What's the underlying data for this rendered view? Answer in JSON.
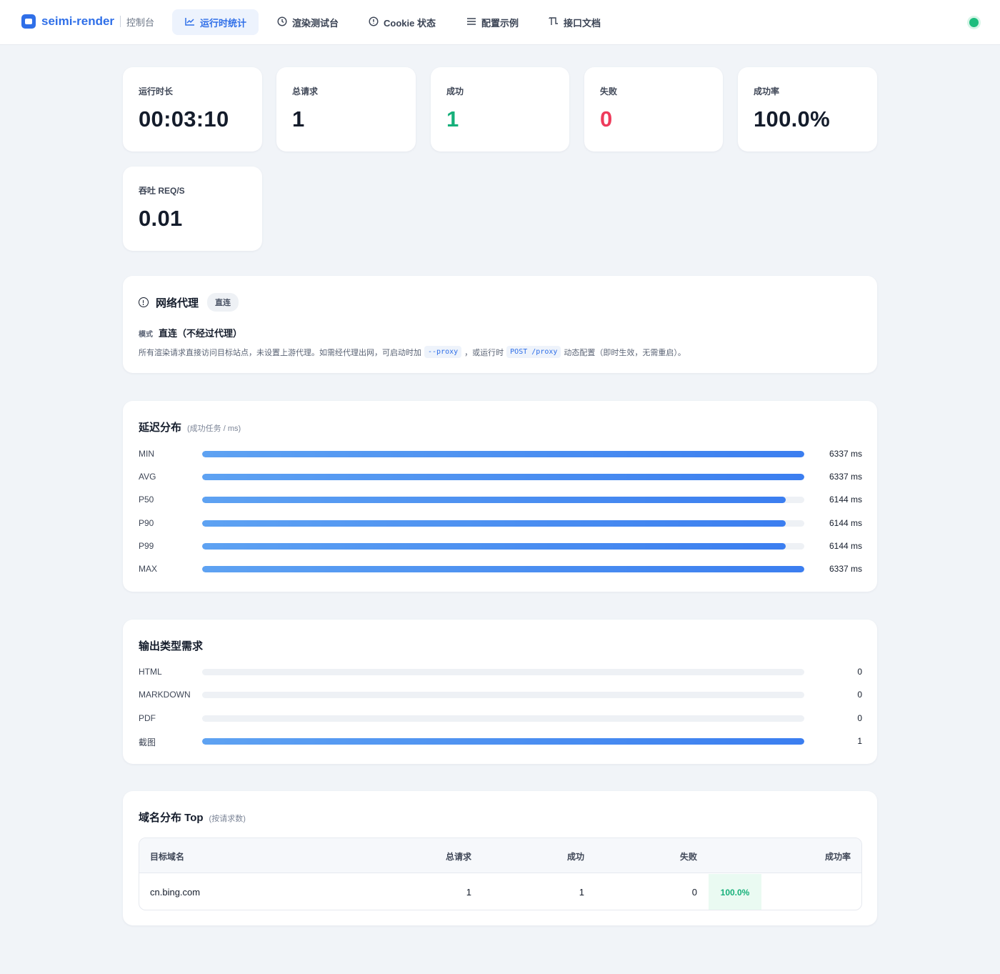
{
  "brand": {
    "name": "seimi-render",
    "subtitle": "控制台"
  },
  "nav": {
    "tabs": [
      {
        "label": "运行时统计",
        "icon": "chart-line-icon",
        "active": true
      },
      {
        "label": "渲染测试台",
        "icon": "clock-icon",
        "active": false
      },
      {
        "label": "Cookie 状态",
        "icon": "info-circle-icon",
        "active": false
      },
      {
        "label": "配置示例",
        "icon": "menu-lines-icon",
        "active": false
      },
      {
        "label": "接口文档",
        "icon": "docs-icon",
        "active": false
      }
    ],
    "status_color": "#1cbd7d"
  },
  "stats": [
    {
      "label": "运行时长",
      "value": "00:03:10"
    },
    {
      "label": "总请求",
      "value": "1"
    },
    {
      "label": "成功",
      "value": "1"
    },
    {
      "label": "失败",
      "value": "0"
    },
    {
      "label": "成功率",
      "value": "100.0%"
    },
    {
      "label": "吞吐 REQ/S",
      "value": "0.01"
    }
  ],
  "proxy": {
    "title": "网络代理",
    "badge": "直连",
    "mode_label": "模式",
    "mode_value": "直连（不经过代理）",
    "desc_1": "所有渲染请求直接访问目标站点，未设置上游代理。如需经代理出网，可启动时加",
    "code_1": "--proxy",
    "desc_2": "，或运行时",
    "code_2": "POST /proxy",
    "desc_3": "动态配置（即时生效，无需重启）。"
  },
  "latency": {
    "title": "延迟分布",
    "subtitle": "(成功任务 / ms)",
    "rows": [
      {
        "label": "MIN",
        "value": 6337,
        "display": "6337 ms"
      },
      {
        "label": "AVG",
        "value": 6337,
        "display": "6337 ms"
      },
      {
        "label": "P50",
        "value": 6144,
        "display": "6144 ms"
      },
      {
        "label": "P90",
        "value": 6144,
        "display": "6144 ms"
      },
      {
        "label": "P99",
        "value": 6144,
        "display": "6144 ms"
      },
      {
        "label": "MAX",
        "value": 6337,
        "display": "6337 ms"
      }
    ],
    "max": 6337
  },
  "output_types": {
    "title": "输出类型需求",
    "rows": [
      {
        "label": "HTML",
        "value": 0,
        "display": "0"
      },
      {
        "label": "MARKDOWN",
        "value": 0,
        "display": "0"
      },
      {
        "label": "PDF",
        "value": 0,
        "display": "0"
      },
      {
        "label": "截图",
        "value": 1,
        "display": "1"
      }
    ],
    "max": 1
  },
  "domains": {
    "title": "域名分布 Top",
    "subtitle": "(按请求数)",
    "headers": {
      "domain": "目标域名",
      "total": "总请求",
      "success": "成功",
      "fail": "失败",
      "rate": "成功率"
    },
    "rows": [
      {
        "domain": "cn.bing.com",
        "total": "1",
        "success": "1",
        "fail": "0",
        "rate": "100.0%"
      }
    ]
  },
  "colors": {
    "accent": "#2f6fe8",
    "success": "#16b07a",
    "danger": "#ee3b5b"
  }
}
